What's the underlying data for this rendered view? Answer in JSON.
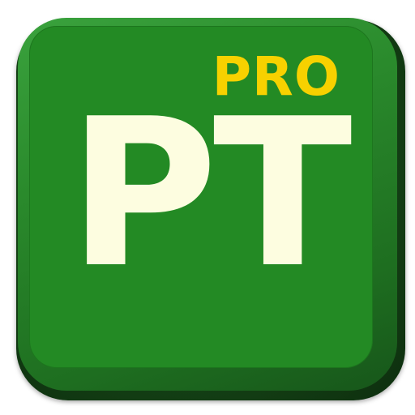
{
  "icon": {
    "badge_text": "PRO",
    "main_text": "PT",
    "colors": {
      "tile_face": "#238a24",
      "tile_rim": "#2a8a2c",
      "tile_shadow": "#154416",
      "badge_text": "#f7d100",
      "main_text": "#fdfde0"
    }
  }
}
